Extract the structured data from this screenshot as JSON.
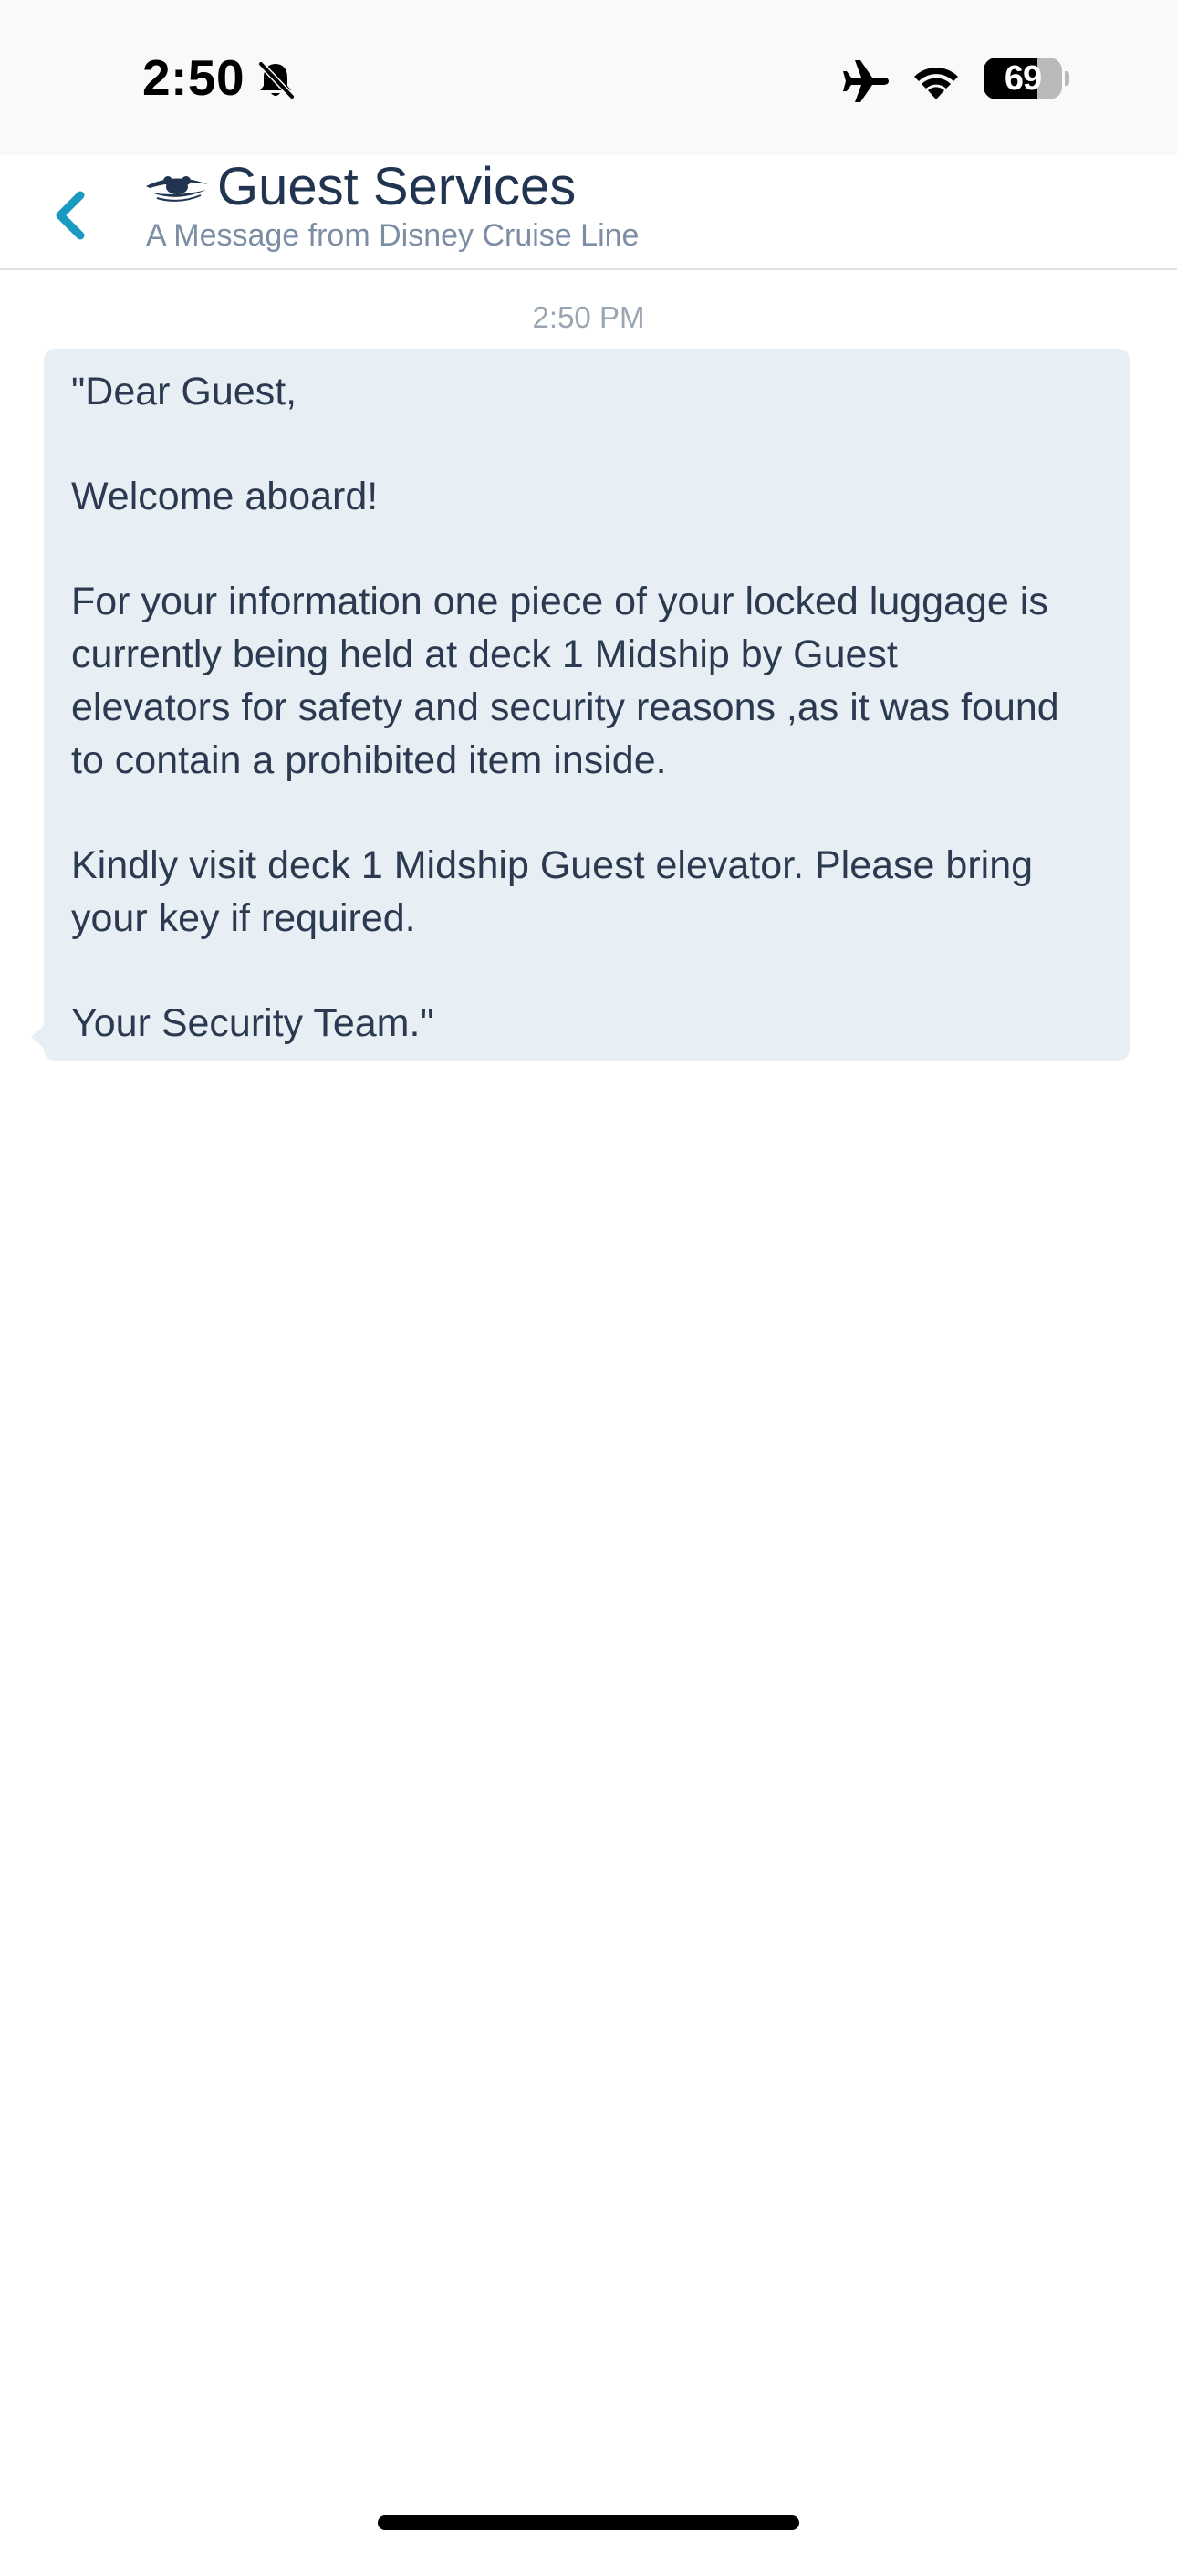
{
  "status_bar": {
    "time": "2:50",
    "battery_level": "69",
    "battery_fraction": 0.69,
    "icons": [
      "bell-slash-icon",
      "airplane-icon",
      "wifi-icon",
      "battery-icon"
    ]
  },
  "header": {
    "title": "Guest Services",
    "subtitle": "A Message from Disney Cruise Line",
    "back_icon": "chevron-left-icon",
    "logo_icon": "disney-cruise-line-logo",
    "accent_color": "#1a9ac0"
  },
  "conversation": {
    "timestamp": "2:50 PM",
    "message": {
      "greeting": "\"Dear Guest,",
      "welcome": "Welcome aboard!",
      "paragraph_1": [
        "For your information one piece of your locked luggage is",
        "currently being held at deck 1 Midship by Guest",
        "elevators for safety and security reasons ,as it was found",
        "to contain a prohibited item inside."
      ],
      "paragraph_2": [
        "Kindly visit deck 1 Midship Guest elevator. Please bring",
        "your key if required."
      ],
      "signoff": "Your Security Team.\""
    },
    "bubble_color": "#e8eff4"
  }
}
